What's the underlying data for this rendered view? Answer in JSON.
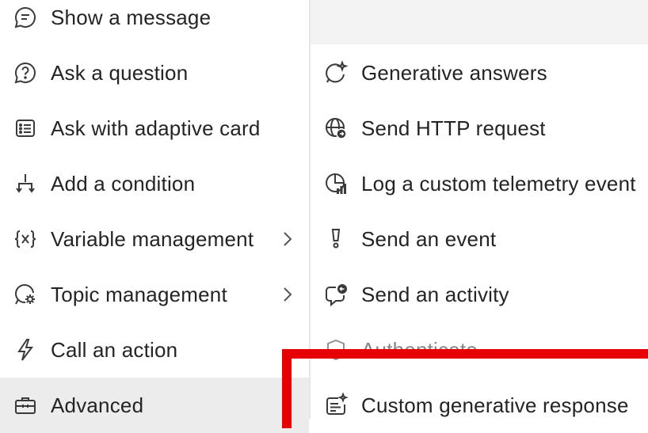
{
  "left_menu": {
    "items": [
      {
        "label": "Show a message",
        "icon": "message-icon"
      },
      {
        "label": "Ask a question",
        "icon": "question-icon"
      },
      {
        "label": "Ask with adaptive card",
        "icon": "adaptive-card-icon"
      },
      {
        "label": "Add a condition",
        "icon": "condition-icon"
      },
      {
        "label": "Variable management",
        "icon": "variable-icon",
        "submenu": true
      },
      {
        "label": "Topic management",
        "icon": "topic-icon",
        "submenu": true
      },
      {
        "label": "Call an action",
        "icon": "lightning-icon"
      },
      {
        "label": "Advanced",
        "icon": "toolbox-icon",
        "submenu": true,
        "selected": true
      }
    ]
  },
  "right_menu": {
    "items": [
      {
        "label": "Generative answers",
        "icon": "sparkle-chat-icon"
      },
      {
        "label": "Send HTTP request",
        "icon": "globe-icon"
      },
      {
        "label": "Log a custom telemetry event",
        "icon": "telemetry-icon"
      },
      {
        "label": "Send an event",
        "icon": "event-icon"
      },
      {
        "label": "Send an activity",
        "icon": "activity-icon"
      },
      {
        "label": "Authenticate",
        "icon": "shield-icon"
      },
      {
        "label": "Custom generative response",
        "icon": "sparkle-list-icon"
      }
    ]
  },
  "colors": {
    "highlight": "#e60000",
    "selected_bg": "#ececec"
  }
}
